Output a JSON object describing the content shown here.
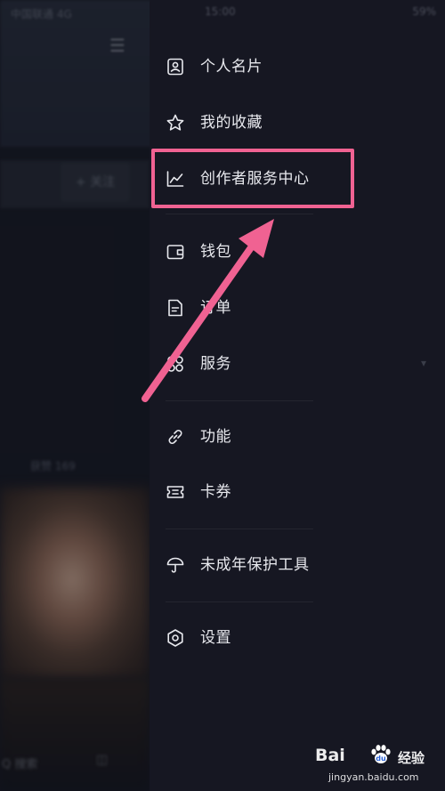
{
  "background_app": {
    "status_carrier": "中国联通 4G",
    "follow_button": "+ 关注",
    "count_text": "获赞 169",
    "bottom_text": "Q 搜索"
  },
  "status_bar": {
    "time": "15:00",
    "battery": "59%"
  },
  "drawer": {
    "items": [
      {
        "label": "个人名片",
        "icon": "profile-card-icon"
      },
      {
        "label": "我的收藏",
        "icon": "star-icon"
      },
      {
        "label": "创作者服务中心",
        "icon": "chart-icon"
      },
      {
        "label": "钱包",
        "icon": "wallet-icon"
      },
      {
        "label": "订单",
        "icon": "document-icon"
      },
      {
        "label": "服务",
        "icon": "grid-icon"
      },
      {
        "label": "功能",
        "icon": "link-icon"
      },
      {
        "label": "卡券",
        "icon": "ticket-icon"
      },
      {
        "label": "未成年保护工具",
        "icon": "umbrella-icon"
      },
      {
        "label": "设置",
        "icon": "settings-icon"
      }
    ]
  },
  "annotation": {
    "highlight_color": "#f06292",
    "highlighted_item": "创作者服务中心"
  },
  "watermark": {
    "brand": "Bai",
    "brand_suffix": "经验",
    "url": "jingyan.baidu.com"
  }
}
